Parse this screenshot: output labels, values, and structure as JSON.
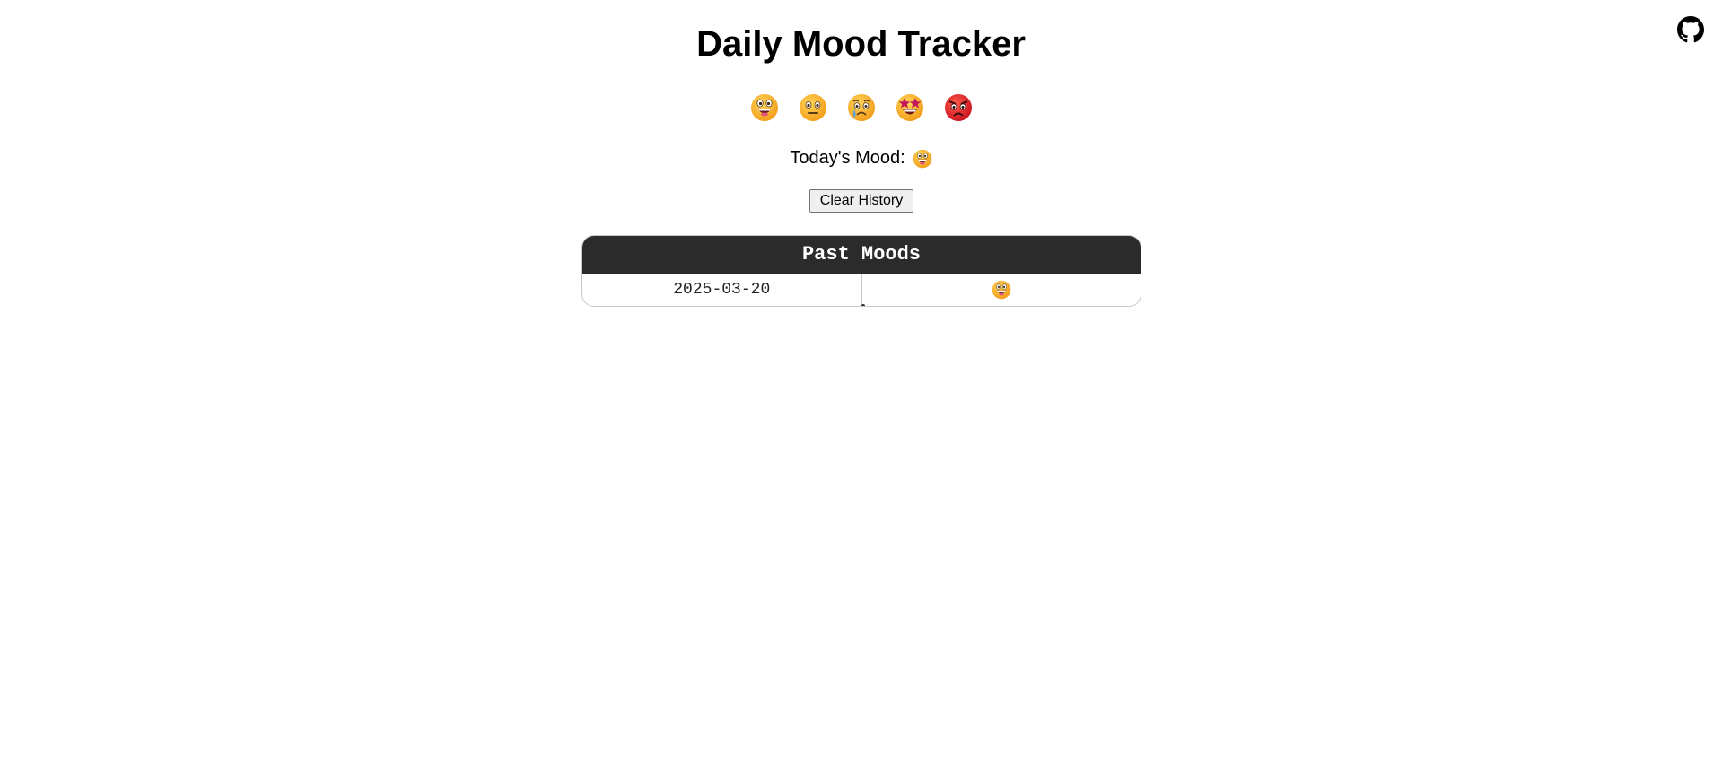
{
  "page": {
    "title": "Daily Mood Tracker"
  },
  "github": {
    "icon": "github-icon"
  },
  "moods": [
    {
      "name": "grinning-face-icon",
      "emoji": "😀"
    },
    {
      "name": "neutral-face-icon",
      "emoji": "😐"
    },
    {
      "name": "crying-face-icon",
      "emoji": "😢"
    },
    {
      "name": "star-struck-face-icon",
      "emoji": "🤩"
    },
    {
      "name": "angry-face-icon",
      "emoji": "😡"
    }
  ],
  "today": {
    "label": "Today's Mood:",
    "mood_icon": "grinning-face-icon"
  },
  "actions": {
    "clear_label": "Clear History"
  },
  "history": {
    "title": "Past Moods",
    "rows": [
      {
        "date": "2025-03-20",
        "mood_icon": "grinning-face-icon"
      }
    ]
  },
  "colors": {
    "header_bg": "#2b2b2b",
    "emoji_yellow": "#f9b21d",
    "emoji_red": "#e0202b"
  }
}
